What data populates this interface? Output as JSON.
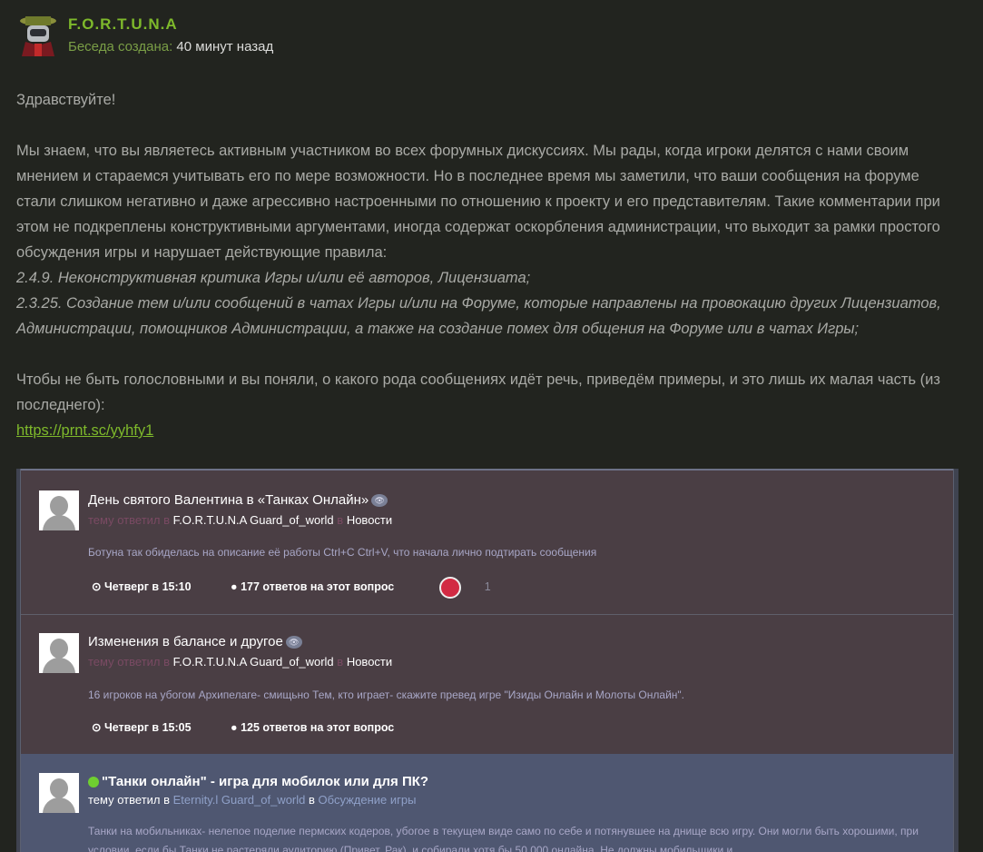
{
  "header": {
    "author": "F.O.R.T.U.N.A",
    "created_label": "Беседа создана:",
    "created_value": "40 минут назад"
  },
  "message": {
    "greeting": "Здравствуйте!",
    "p1": "Мы знаем, что вы являетесь активным участником во всех форумных дискуссиях. Мы рады, когда игроки делятся с нами своим мнением и стараемся учитывать его по мере возможности. Но в последнее время мы заметили, что ваши сообщения на форуме стали слишком негативно и даже агрессивно настроенными по отношению к проекту и его представителям. Такие комментарии при этом не подкреплены конструктивными аргументами, иногда содержат оскорбления администрации, что выходит за рамки простого обсуждения игры и нарушает действующие правила:",
    "rule1": "2.4.9. Неконструктивная критика Игры и/или её авторов, Лицензиата;",
    "rule2": "2.3.25. Создание тем и/или сообщений в чатах Игры и/или на Форуме, которые направлены на провокацию других Лицензиатов, Администрации, помощников Администрации, а также на создание помех для общения на Форуме или в чатах Игры;",
    "p2": "Чтобы не быть голословными и вы поняли, о какого рода сообщениях идёт речь, приведём примеры, и это лишь их малая часть (из последнего):",
    "link": "https://prnt.sc/yyhfy1"
  },
  "topics": [
    {
      "title": "День святого Валентина в «Танках Онлайн»",
      "answered_by": "тему ответил в",
      "authors": "F.O.R.T.U.N.A Guard_of_world",
      "in": "в",
      "forum": "Новости",
      "desc": "Ботуна так обиделась на описание её работы Ctrl+C Ctrl+V, что начала лично подтирать сообщения",
      "time": "Четверг в 15:10",
      "replies": "177 ответов на этот вопрос",
      "reaction_count": "1"
    },
    {
      "title": "Изменения в балансе и другое",
      "answered_by": "тему ответил в",
      "authors": "F.O.R.T.U.N.A Guard_of_world",
      "in": "в",
      "forum": "Новости",
      "desc": "16 игроков на убогом Архипелаге- смищьно Тем, кто играет- скажите превед игре \"Изиды Онлайн и Молоты Онлайн\".",
      "time": "Четверг в 15:05",
      "replies": "125 ответов на этот вопрос"
    },
    {
      "title": "\"Танки онлайн\" - игра для мобилок или для ПК?",
      "answered_by": "тему ответил в",
      "author_a": "Eternity.l",
      "author_b": "Guard_of_world",
      "in": "в",
      "forum": "Обсуждение игры",
      "desc": "Танки на мобильниках- нелепое поделие пермских кодеров, убогое в текущем виде само по себе и потянувшее на днище всю игру. Они могли быть хорошими, при условии, если бы Танки не растеряли аудиторию (Привет, Рак), и собирали хотя бы 50 000 онлайна. Не должны мобильщики и"
    }
  ]
}
